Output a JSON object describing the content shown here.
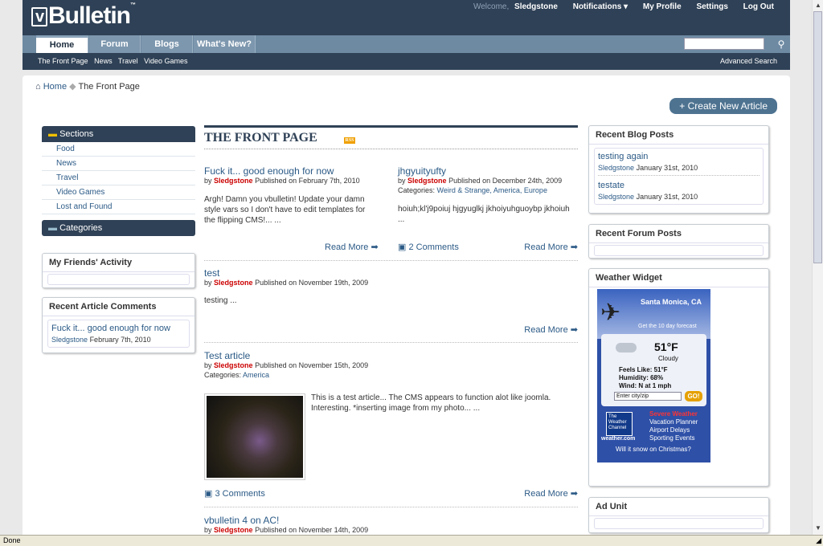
{
  "brand": {
    "name": "Bulletin",
    "tm": "™"
  },
  "toplinks": {
    "welcome": "Welcome,",
    "user": "Sledgstone",
    "notifications": "Notifications ▾",
    "profile": "My Profile",
    "settings": "Settings",
    "logout": "Log Out"
  },
  "tabs": [
    "Home",
    "Forum",
    "Blogs",
    "What's New?"
  ],
  "subnav": {
    "items": [
      "The Front Page",
      "News",
      "Travel",
      "Video Games"
    ],
    "advanced": "Advanced Search"
  },
  "breadcrumb": {
    "home": "Home",
    "current": "The Front Page"
  },
  "create_label": "+ Create New Article",
  "sections": {
    "title": "Sections",
    "items": [
      "Food",
      "News",
      "Travel",
      "Video Games",
      "Lost and Found"
    ]
  },
  "categories_title": "Categories",
  "friends": {
    "title": "My Friends' Activity"
  },
  "recent_comments": {
    "title": "Recent Article Comments",
    "link": "Fuck it... good enough for now",
    "author": "Sledgstone",
    "date": "February 7th, 2010"
  },
  "front_page_title": "THE FRONT PAGE",
  "articles": [
    {
      "title": "Fuck it... good enough for now",
      "author": "Sledgstone",
      "published": "Published on February 7th, 2010",
      "body": "Argh! Damn you vbulletin! Update your damn style vars so I don't have to edit templates for the flipping CMS!... ...",
      "read_more": "Read More"
    },
    {
      "title": "jhgyuityufty",
      "author": "Sledgstone",
      "published": "Published on December 24th, 2009",
      "categories_label": "Categories:",
      "categories": "Weird & Strange, America, Europe",
      "body": "hoiuh;kl'j9poiuj hjgyuglkj jkhoiyuhguoybp jkhoiuh ...",
      "comments": "2 Comments",
      "read_more": "Read More"
    },
    {
      "title": "test",
      "author": "Sledgstone",
      "published": "Published on November 19th, 2009",
      "body": "testing ...",
      "read_more": "Read More"
    },
    {
      "title": "Test article",
      "author": "Sledgstone",
      "published": "Published on November 15th, 2009",
      "categories_label": "Categories:",
      "categories": "America",
      "body": "This is a test article... The CMS appears to function alot like joomla. Interesting. *inserting image from my photo... ...",
      "comments": "3 Comments",
      "read_more": "Read More"
    },
    {
      "title": "vbulletin 4 on AC!",
      "author": "Sledgstone",
      "published": "Published on November 14th, 2009"
    }
  ],
  "by_label": "by",
  "blog_posts": {
    "title": "Recent Blog Posts",
    "items": [
      {
        "title": "testing again",
        "author": "Sledgstone",
        "date": "January 31st, 2010"
      },
      {
        "title": "testate",
        "author": "Sledgstone",
        "date": "January 31st, 2010"
      }
    ]
  },
  "forum_posts": {
    "title": "Recent Forum Posts"
  },
  "weather": {
    "title": "Weather Widget",
    "city": "Santa Monica, CA",
    "forecast": "Get the 10 day forecast",
    "temp": "51°F",
    "condition": "Cloudy",
    "feels": "Feels Like: 51°F",
    "humidity": "Humidity: 68%",
    "wind": "Wind: N at 1 mph",
    "input_placeholder": "Enter city/zip",
    "go": "GO!",
    "channel": "The Weather Channel",
    "site": "weather.com",
    "links": [
      "Severe Weather",
      "Vacation Planner",
      "Airport Delays",
      "Sporting Events"
    ],
    "question": "Will it snow on Christmas?"
  },
  "ad_unit": {
    "title": "Ad Unit"
  },
  "status": "Done"
}
